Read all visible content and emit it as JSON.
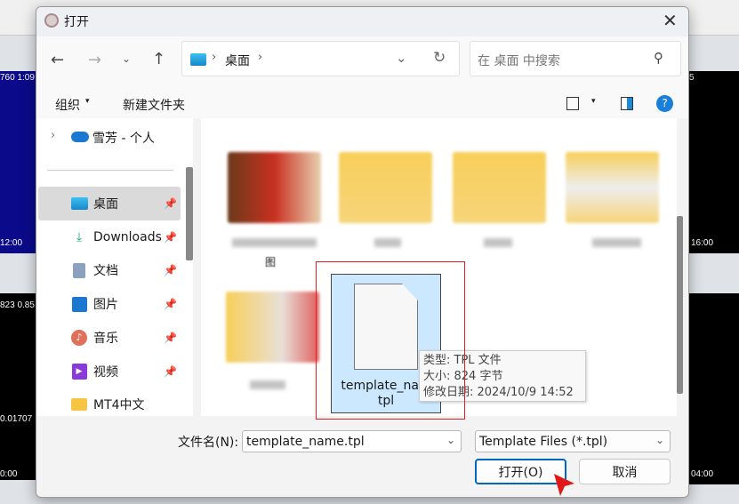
{
  "background": {
    "left_price_top": "760 1:09",
    "left_time_top": "12:00",
    "left_price_mid": "823 0.85",
    "left_price_low": "0.01707",
    "left_time_low": "0:00",
    "right_time_top": "16:00",
    "right_time_low": "04:00",
    "right_price_top": "5"
  },
  "dialog": {
    "title": "打开",
    "close_icon": "close-icon"
  },
  "address": {
    "location": "桌面",
    "search_placeholder": "在 桌面 中搜索"
  },
  "toolbar": {
    "organize": "组织",
    "new_folder": "新建文件夹"
  },
  "nav": {
    "onedrive": "雪芳 - 个人",
    "items": [
      {
        "label": "桌面",
        "icon": "desktop-icon",
        "pinned": true,
        "selected": true
      },
      {
        "label": "Downloads",
        "icon": "download-icon",
        "pinned": true
      },
      {
        "label": "文档",
        "icon": "document-icon",
        "pinned": true
      },
      {
        "label": "图片",
        "icon": "pictures-icon",
        "pinned": true
      },
      {
        "label": "音乐",
        "icon": "music-icon",
        "pinned": true
      },
      {
        "label": "视频",
        "icon": "video-icon",
        "pinned": true
      },
      {
        "label": "MT4中文",
        "icon": "folder-icon"
      }
    ]
  },
  "files": {
    "partial_label": "图",
    "selected_file": {
      "name_line1": "template_nam",
      "name_line2": "tpl"
    }
  },
  "tooltip": {
    "type": "类型: TPL 文件",
    "size": "大小: 824 字节",
    "modified": "修改日期: 2024/10/9 14:52"
  },
  "footer": {
    "filename_label": "文件名(N):",
    "filename_value": "template_name.tpl",
    "filter": "Template Files (*.tpl)",
    "open": "打开(O)",
    "cancel": "取消"
  },
  "colors": {
    "highlight": "#e02020",
    "selection": "#cce8ff",
    "accent": "#0067c0"
  }
}
